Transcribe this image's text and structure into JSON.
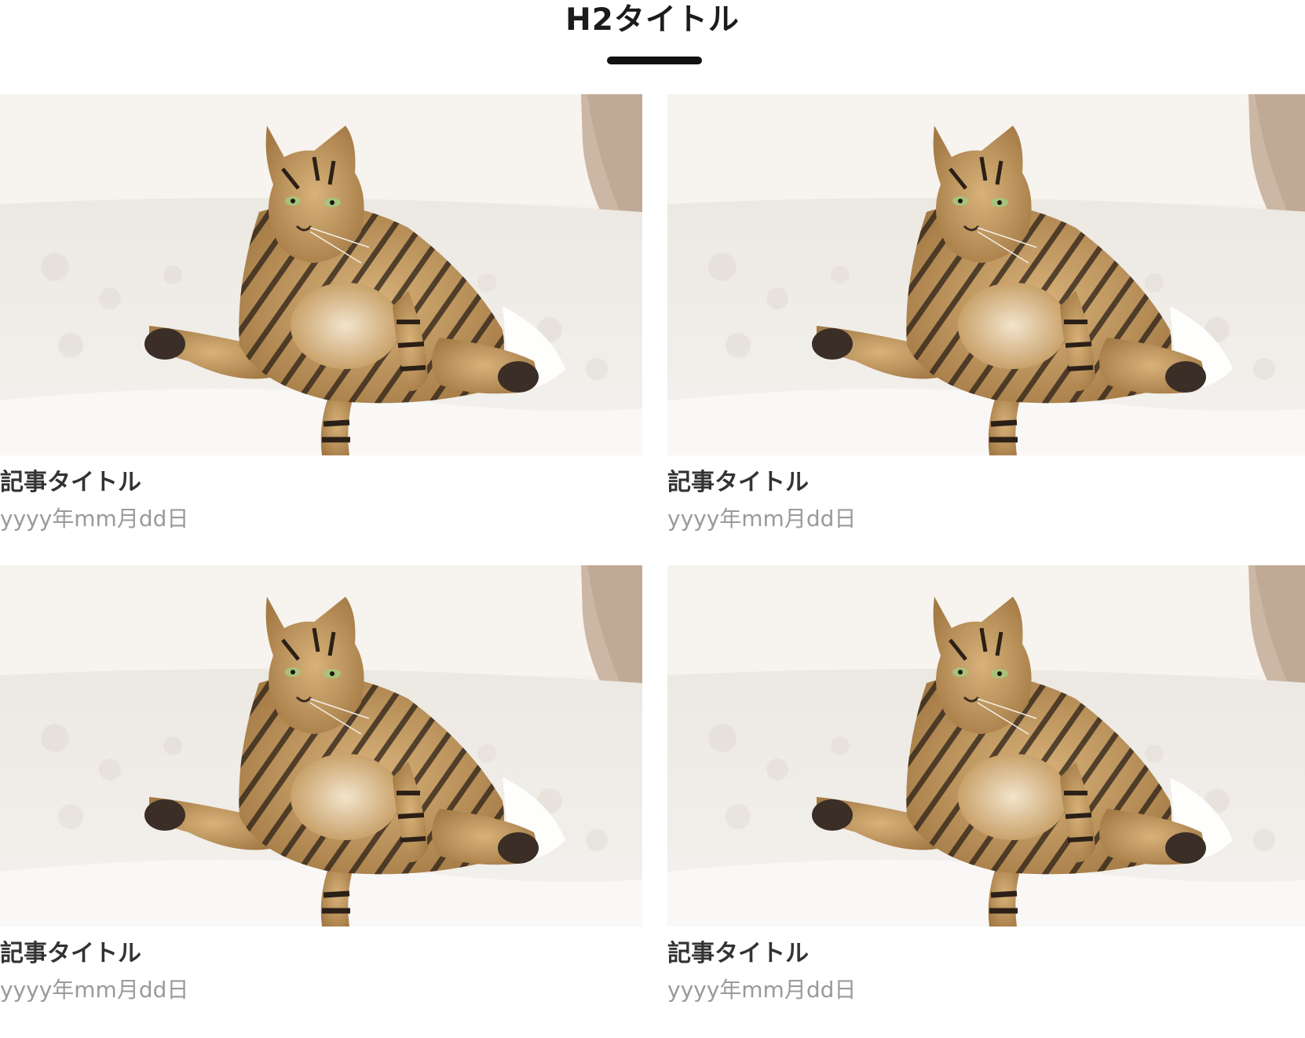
{
  "section": {
    "title": "H2タイトル"
  },
  "cards": [
    {
      "title": "記事タイトル",
      "date": "yyyy年mm月dd日",
      "image": "tabby-cat-sitting-on-bed-photo"
    },
    {
      "title": "記事タイトル",
      "date": "yyyy年mm月dd日",
      "image": "tabby-cat-sitting-on-bed-photo"
    },
    {
      "title": "記事タイトル",
      "date": "yyyy年mm月dd日",
      "image": "tabby-cat-sitting-on-bed-photo"
    },
    {
      "title": "記事タイトル",
      "date": "yyyy年mm月dd日",
      "image": "tabby-cat-sitting-on-bed-photo"
    }
  ],
  "colors": {
    "title_text": "#1b1b1b",
    "underline": "#111111",
    "card_title_text": "#333333",
    "date_text": "#9a9a9a",
    "background": "#ffffff"
  }
}
